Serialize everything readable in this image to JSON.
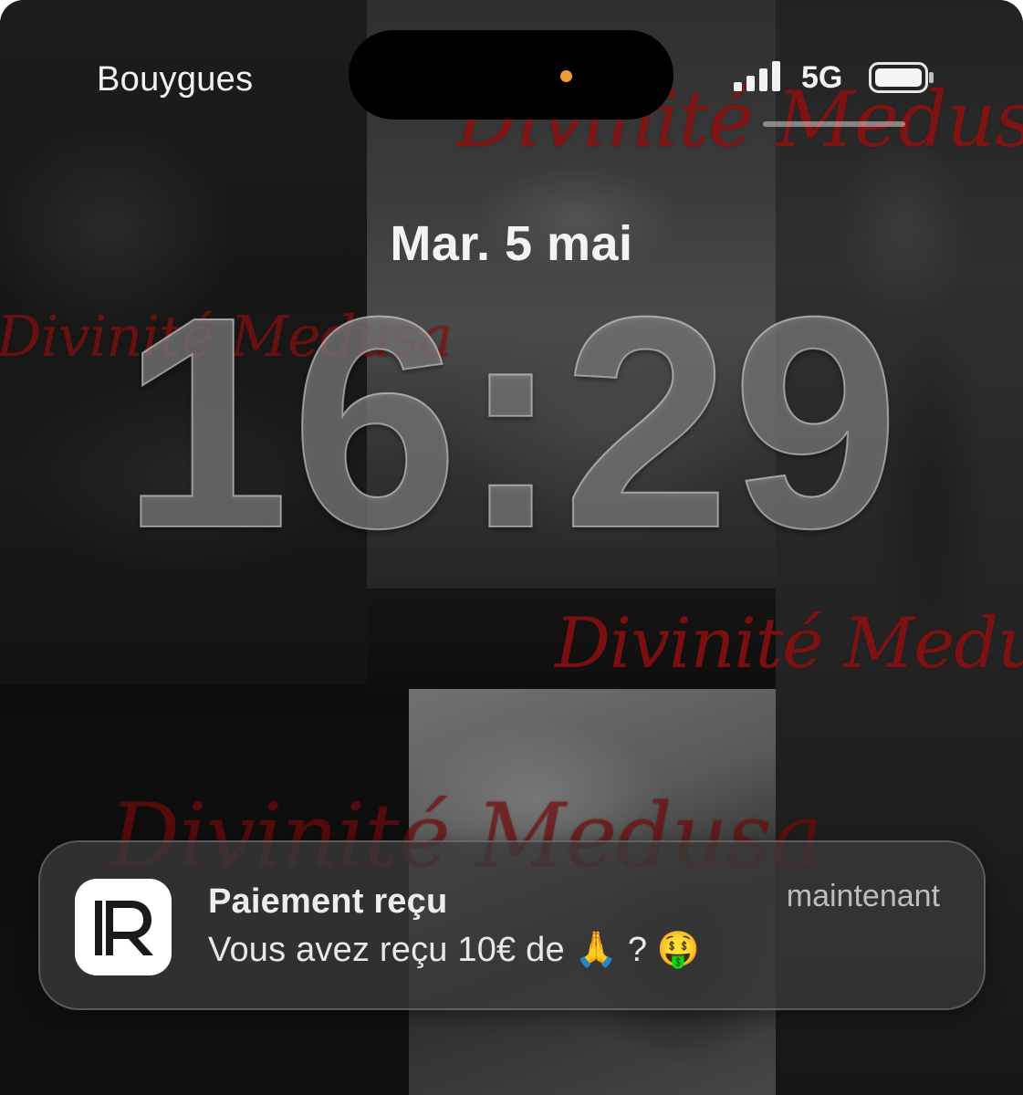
{
  "status_bar": {
    "carrier": "Bouygues",
    "network": "5G",
    "signal_icon": "cellular-signal-icon",
    "battery_icon": "battery-full-icon",
    "privacy_dot_color": "#f29a3a"
  },
  "lock_screen": {
    "date": "Mar. 5 mai",
    "time": "16:29"
  },
  "wallpaper": {
    "watermark_text": "Divinité Medusa"
  },
  "notification": {
    "app_icon": "r-logo-app-icon",
    "title": "Paiement reçu",
    "time": "maintenant",
    "body": "Vous avez reçu 10€ de 🙏 ? 🤑"
  }
}
